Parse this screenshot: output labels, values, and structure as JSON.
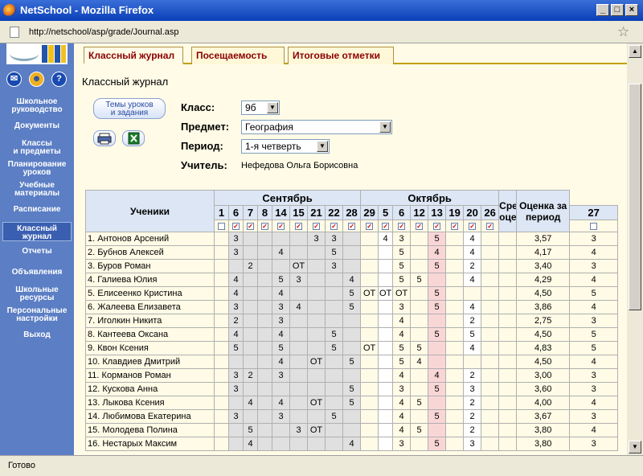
{
  "window": {
    "title": "NetSchool - Mozilla Firefox",
    "url": "http://netschool/asp/grade/Journal.asp",
    "status": "Готово"
  },
  "sidebar": {
    "icons": [
      "mail-icon",
      "users-icon",
      "help-icon"
    ],
    "help_glyph": "?",
    "items": [
      {
        "label": "Школьное\nруководство"
      },
      {
        "label": "Документы"
      },
      {
        "label": "Классы\nи предметы"
      },
      {
        "label": "Планирование\nуроков"
      },
      {
        "label": "Учебные\nматериалы"
      },
      {
        "label": "Расписание"
      },
      {
        "label": "Классный\nжурнал"
      },
      {
        "label": "Отчеты"
      },
      {
        "label": "Объявления"
      },
      {
        "label": "Школьные\nресурсы"
      },
      {
        "label": "Персональные\nнастройки"
      },
      {
        "label": "Выход"
      }
    ]
  },
  "tabs": [
    "Классный журнал",
    "Посещаемость",
    "Итоговые отметки"
  ],
  "page": {
    "title": "Классный журнал",
    "topics_button": "Темы уроков\nи задания",
    "class_label": "Класс:",
    "class_value": "9б",
    "subject_label": "Предмет:",
    "subject_value": "География",
    "period_label": "Период:",
    "period_value": "1-я четверть",
    "teacher_label": "Учитель:",
    "teacher_value": "Нефедова Ольга Борисовна"
  },
  "journal": {
    "students_header": "Ученики",
    "avg_header": "Средняя оценка",
    "period_header": "Оценка за период",
    "months": [
      {
        "name": "Сентябрь",
        "span": 9
      },
      {
        "name": "Октябрь",
        "span": 8
      }
    ],
    "days": [
      "1",
      "6",
      "7",
      "8",
      "14",
      "15",
      "21",
      "22",
      "28",
      "29",
      "5",
      "6",
      "12",
      "13",
      "19",
      "20",
      "26",
      "27"
    ],
    "checked": [
      false,
      true,
      true,
      true,
      true,
      true,
      true,
      true,
      true,
      true,
      true,
      true,
      true,
      true,
      true,
      true,
      true,
      false
    ],
    "check_glyph": "✓",
    "rows": [
      {
        "name": "1. Антонов Арсений",
        "marks": [
          "",
          "3",
          "",
          "",
          "",
          "",
          "3",
          "3",
          "",
          "",
          "4",
          "3",
          "",
          "5",
          "",
          "4",
          "",
          ""
        ],
        "avg": "3,57",
        "period": "3"
      },
      {
        "name": "2. Бубнов Алексей",
        "marks": [
          "",
          "3",
          "",
          "",
          "4",
          "",
          "",
          "5",
          "",
          "",
          "",
          "5",
          "",
          "4",
          "",
          "4",
          "",
          ""
        ],
        "avg": "4,17",
        "period": "4"
      },
      {
        "name": "3. Буров Роман",
        "marks": [
          "",
          "",
          "2",
          "",
          "",
          "ОТ",
          "",
          "3",
          "",
          "",
          "",
          "5",
          "",
          "5",
          "",
          "2",
          "",
          ""
        ],
        "avg": "3,40",
        "period": "3"
      },
      {
        "name": "4. Галиева Юлия",
        "marks": [
          "",
          "4",
          "",
          "",
          "5",
          "3",
          "",
          "",
          "4",
          "",
          "",
          "5",
          "5",
          "",
          "",
          "4",
          "",
          ""
        ],
        "avg": "4,29",
        "period": "4"
      },
      {
        "name": "5. Елисеенко Кристина",
        "marks": [
          "",
          "4",
          "",
          "",
          "4",
          "",
          "",
          "",
          "5",
          "ОТ",
          "ОТ",
          "ОТ",
          "",
          "5",
          "",
          "",
          "",
          ""
        ],
        "avg": "4,50",
        "period": "5"
      },
      {
        "name": "6. Жалеева Елизавета",
        "marks": [
          "",
          "3",
          "",
          "",
          "3",
          "4",
          "",
          "",
          "5",
          "",
          "",
          "3",
          "",
          "5",
          "",
          "4",
          "",
          ""
        ],
        "avg": "3,86",
        "period": "4"
      },
      {
        "name": "7. Иголкин Никита",
        "marks": [
          "",
          "2",
          "",
          "",
          "3",
          "",
          "",
          "",
          "",
          "",
          "",
          "4",
          "",
          "",
          "",
          "2",
          "",
          ""
        ],
        "avg": "2,75",
        "period": "3"
      },
      {
        "name": "8. Кантеева Оксана",
        "marks": [
          "",
          "4",
          "",
          "",
          "4",
          "",
          "",
          "5",
          "",
          "",
          "",
          "4",
          "",
          "5",
          "",
          "5",
          "",
          ""
        ],
        "avg": "4,50",
        "period": "5"
      },
      {
        "name": "9. Квон Ксения",
        "marks": [
          "",
          "5",
          "",
          "",
          "5",
          "",
          "",
          "5",
          "",
          "ОТ",
          "",
          "5",
          "5",
          "",
          "",
          "4",
          "",
          ""
        ],
        "avg": "4,83",
        "period": "5"
      },
      {
        "name": "10. Клавдиев Дмитрий",
        "marks": [
          "",
          "",
          "",
          "",
          "4",
          "",
          "ОТ",
          "",
          "5",
          "",
          "",
          "5",
          "4",
          "",
          "",
          "",
          "",
          ""
        ],
        "avg": "4,50",
        "period": "4"
      },
      {
        "name": "11. Корманов Роман",
        "marks": [
          "",
          "3",
          "2",
          "",
          "3",
          "",
          "",
          "",
          "",
          "",
          "",
          "4",
          "",
          "4",
          "",
          "2",
          "",
          ""
        ],
        "avg": "3,00",
        "period": "3"
      },
      {
        "name": "12. Кускова Анна",
        "marks": [
          "",
          "3",
          "",
          "",
          "",
          "",
          "",
          "",
          "5",
          "",
          "",
          "3",
          "",
          "5",
          "",
          "3",
          "",
          ""
        ],
        "avg": "3,60",
        "period": "3"
      },
      {
        "name": "13. Лыкова Ксения",
        "marks": [
          "",
          "",
          "4",
          "",
          "4",
          "",
          "ОТ",
          "",
          "5",
          "",
          "",
          "4",
          "5",
          "",
          "",
          "2",
          "",
          ""
        ],
        "avg": "4,00",
        "period": "4"
      },
      {
        "name": "14. Любимова Екатерина",
        "marks": [
          "",
          "3",
          "",
          "",
          "3",
          "",
          "",
          "5",
          "",
          "",
          "",
          "4",
          "",
          "5",
          "",
          "2",
          "",
          ""
        ],
        "avg": "3,67",
        "period": "3"
      },
      {
        "name": "15. Молодева Полина",
        "marks": [
          "",
          "",
          "5",
          "",
          "",
          "3",
          "ОТ",
          "",
          "",
          "",
          "",
          "4",
          "5",
          "",
          "",
          "2",
          "",
          ""
        ],
        "avg": "3,80",
        "period": "4"
      },
      {
        "name": "16. Нестарых Максим",
        "marks": [
          "",
          "",
          "4",
          "",
          "",
          "",
          "",
          "",
          "4",
          "",
          "",
          "3",
          "",
          "5",
          "",
          "3",
          "",
          ""
        ],
        "avg": "3,80",
        "period": "3"
      }
    ]
  }
}
